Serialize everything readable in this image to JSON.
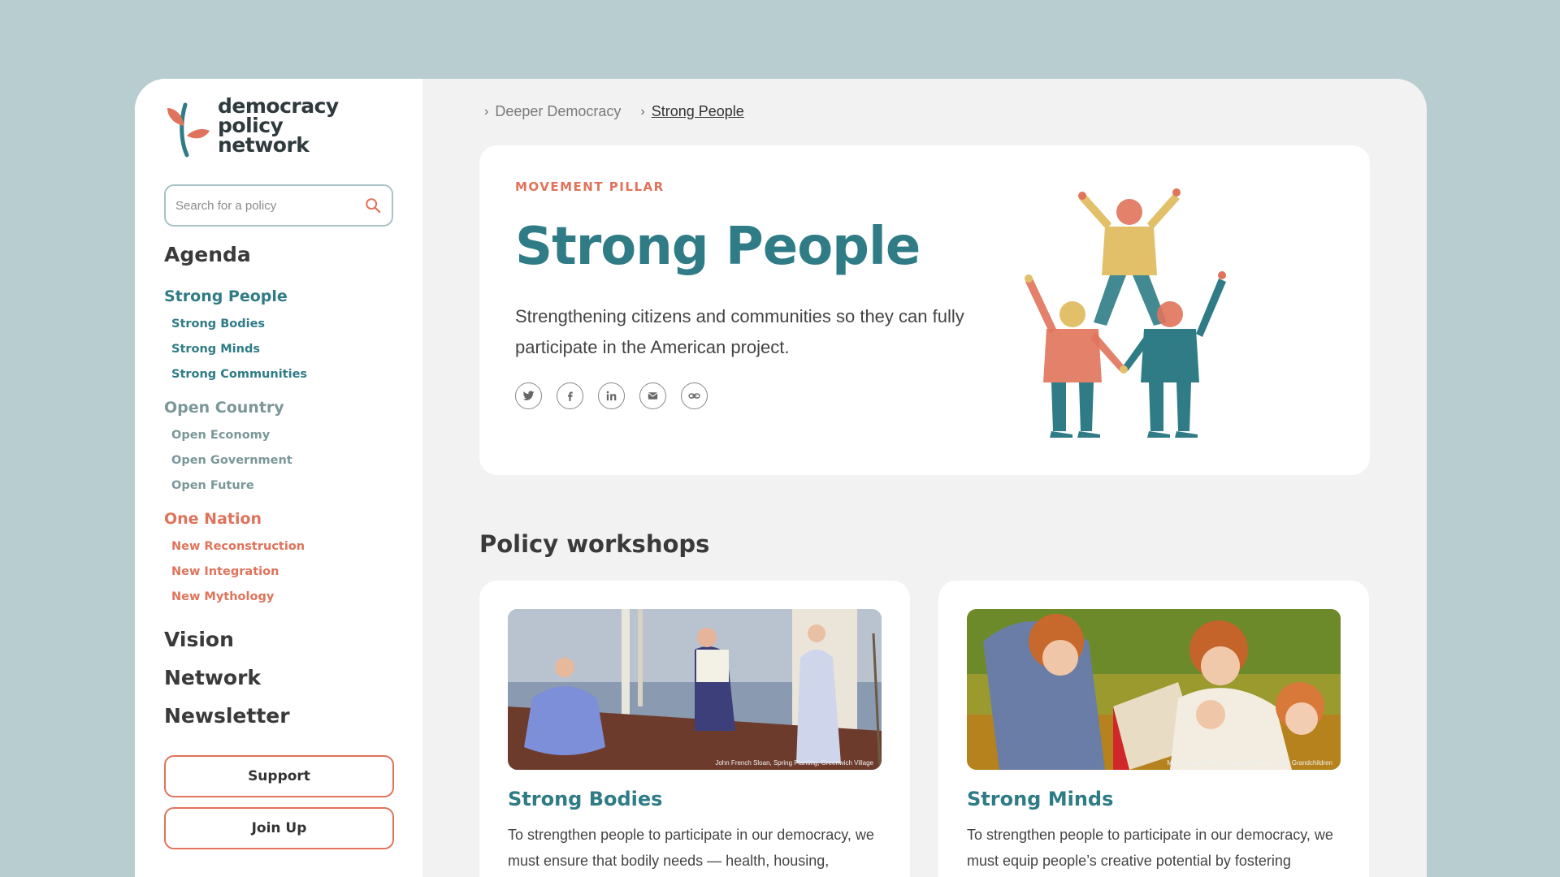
{
  "brand": {
    "line1": "democracy",
    "line2": "policy",
    "line3": "network"
  },
  "search": {
    "placeholder": "Search for a policy"
  },
  "nav": {
    "agenda": "Agenda",
    "groups": [
      {
        "title": "Strong People",
        "items": [
          "Strong Bodies",
          "Strong Minds",
          "Strong Communities"
        ]
      },
      {
        "title": "Open Country",
        "items": [
          "Open Economy",
          "Open Government",
          "Open Future"
        ]
      },
      {
        "title": "One Nation",
        "items": [
          "New Reconstruction",
          "New Integration",
          "New Mythology"
        ]
      }
    ],
    "links": [
      "Vision",
      "Network",
      "Newsletter"
    ],
    "support_label": "Support",
    "join_label": "Join Up"
  },
  "breadcrumb": [
    "Deeper Democracy",
    "Strong People"
  ],
  "hero": {
    "eyebrow": "MOVEMENT PILLAR",
    "title": "Strong People",
    "description": "Strengthening citizens and communities so they can fully participate in the American project.",
    "share_icons": [
      "twitter-icon",
      "facebook-icon",
      "linkedin-icon",
      "email-icon",
      "link-icon"
    ]
  },
  "workshops": {
    "title": "Policy workshops",
    "cards": [
      {
        "title": "Strong Bodies",
        "text": "To strengthen people to participate in our democracy, we must ensure that bodily needs — health, housing,",
        "caption": "John French Sloan, Spring Planting, Greenwich Village"
      },
      {
        "title": "Strong Minds",
        "text": "To strengthen people to participate in our democracy, we must equip people’s creative potential by fostering",
        "caption": "Mary Cassatt, Mrs. Cassatt Reading to her Grandchildren"
      }
    ]
  },
  "colors": {
    "teal": "#2f7c86",
    "coral": "#e0735b",
    "grey": "#7c9799",
    "mustard": "#e2c06a",
    "background": "#b7cdcf"
  }
}
